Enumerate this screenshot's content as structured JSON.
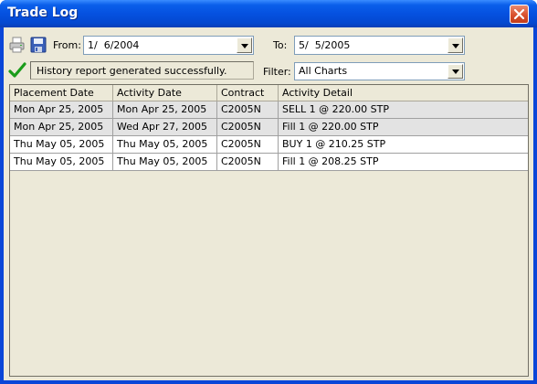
{
  "window": {
    "title": "Trade Log"
  },
  "toolbar": {
    "from_label": "From:",
    "from_value": "1/  6/2004",
    "to_label": "To:",
    "to_value": "5/  5/2005",
    "filter_label": "Filter:",
    "filter_value": "All Charts",
    "status_text": "History report generated successfully."
  },
  "table": {
    "columns": [
      "Placement Date",
      "Activity Date",
      "Contract",
      "Activity Detail"
    ],
    "rows": [
      {
        "placement": "Mon Apr 25, 2005",
        "activity": "Mon Apr 25, 2005",
        "contract": "C2005N",
        "detail": "SELL 1 @ 220.00 STP",
        "shaded": true
      },
      {
        "placement": "Mon Apr 25, 2005",
        "activity": "Wed Apr 27, 2005",
        "contract": "C2005N",
        "detail": "Fill 1 @ 220.00 STP",
        "shaded": true
      },
      {
        "placement": "Thu May 05, 2005",
        "activity": "Thu May 05, 2005",
        "contract": "C2005N",
        "detail": "BUY 1 @ 210.25 STP",
        "shaded": false
      },
      {
        "placement": "Thu May 05, 2005",
        "activity": "Thu May 05, 2005",
        "contract": "C2005N",
        "detail": "Fill 1 @ 208.25 STP",
        "shaded": false
      }
    ]
  },
  "colors": {
    "title_bar": "#0551e0",
    "window_bg": "#ece9d8",
    "row_shaded": "#e3e3e3",
    "row_plain": "#ffffff",
    "success_check": "#1a9c1a"
  },
  "icons": [
    "printer-icon",
    "save-icon",
    "checkmark-icon",
    "close-icon",
    "dropdown-arrow-icon"
  ]
}
